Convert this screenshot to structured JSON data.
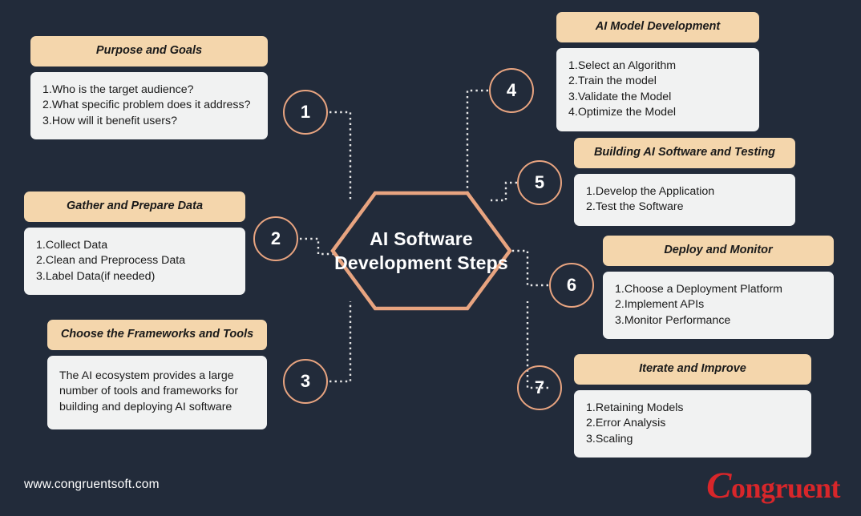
{
  "colors": {
    "background": "#222b3a",
    "accent": "#e8a480",
    "header_band": "#f4d6ac",
    "card_body": "#f1f2f2",
    "text_light": "#ffffff",
    "text_dark": "#1a1a1a",
    "logo_red": "#d8262a",
    "connector": "#e8e8e8"
  },
  "center": {
    "title": "AI Software Development Steps",
    "shape": "hexagon"
  },
  "steps": [
    {
      "number": "1",
      "side": "left"
    },
    {
      "number": "2",
      "side": "left"
    },
    {
      "number": "3",
      "side": "left"
    },
    {
      "number": "4",
      "side": "right"
    },
    {
      "number": "5",
      "side": "right"
    },
    {
      "number": "6",
      "side": "right"
    },
    {
      "number": "7",
      "side": "right"
    }
  ],
  "cards": [
    {
      "id": "purpose-and-goals",
      "title": "Purpose and Goals",
      "items": [
        "Who is the target audience?",
        "What specific problem does it address?",
        "How will it benefit users?"
      ],
      "paragraph": ""
    },
    {
      "id": "gather-and-prepare-data",
      "title": "Gather and Prepare Data",
      "items": [
        "Collect Data",
        "Clean and Preprocess Data",
        "Label Data(if needed)"
      ],
      "paragraph": ""
    },
    {
      "id": "choose-the-frameworks-and-tools",
      "title": "Choose the Frameworks and Tools",
      "items": [],
      "paragraph": "The AI ecosystem provides a large number of tools and frameworks for building and deploying AI software"
    },
    {
      "id": "ai-model-development",
      "title": "AI Model Development",
      "items": [
        "Select an Algorithm",
        "Train the model",
        "Validate the Model",
        "Optimize the Model"
      ],
      "paragraph": ""
    },
    {
      "id": "building-ai-software-and-testing",
      "title": "Building AI Software and Testing",
      "items": [
        "Develop the Application",
        "Test the Software"
      ],
      "paragraph": ""
    },
    {
      "id": "deploy-and-monitor",
      "title": "Deploy and Monitor",
      "items": [
        "Choose a Deployment Platform",
        "Implement APIs",
        "Monitor Performance"
      ],
      "paragraph": ""
    },
    {
      "id": "iterate-and-improve",
      "title": "Iterate and Improve",
      "items": [
        "Retaining Models",
        "Error Analysis",
        "Scaling"
      ],
      "paragraph": ""
    }
  ],
  "footer": {
    "url": "www.congruentsoft.com",
    "logo_initial": "C",
    "logo_rest": "ongruent"
  }
}
